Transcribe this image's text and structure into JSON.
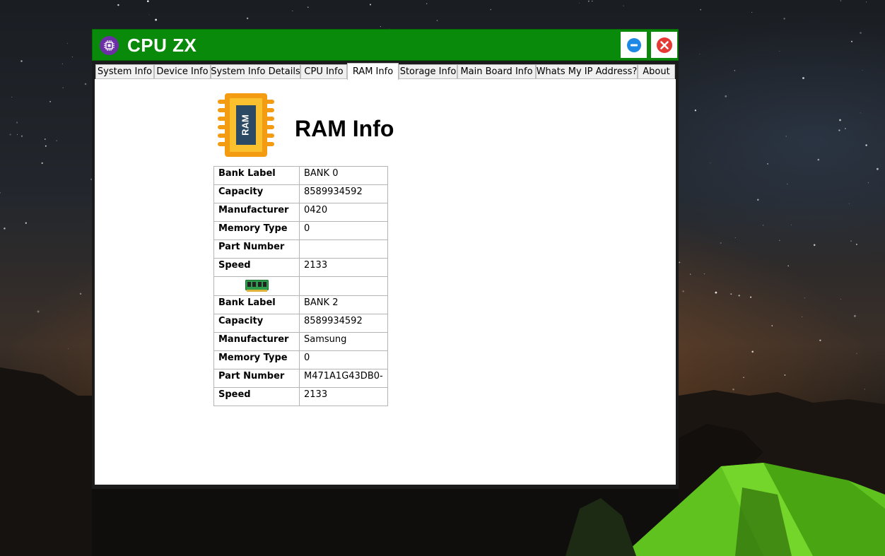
{
  "app": {
    "title": "CPU ZX"
  },
  "window_controls": {
    "minimize_icon": "minimize-icon",
    "close_icon": "close-icon"
  },
  "tabs": [
    {
      "label": "System Info",
      "active": false
    },
    {
      "label": "Device Info",
      "active": false
    },
    {
      "label": "System Info Details",
      "active": false
    },
    {
      "label": "CPU Info",
      "active": false
    },
    {
      "label": "RAM Info",
      "active": true
    },
    {
      "label": "Storage Info",
      "active": false
    },
    {
      "label": "Main Board Info",
      "active": false
    },
    {
      "label": "Whats My IP Address?",
      "active": false
    },
    {
      "label": "About",
      "active": false
    }
  ],
  "page": {
    "heading": "RAM Info",
    "icon": "ram-chip-icon",
    "icon_text": "RAM"
  },
  "banks": [
    {
      "rows": [
        {
          "label": "Bank Label",
          "value": "BANK 0"
        },
        {
          "label": "Capacity",
          "value": "8589934592"
        },
        {
          "label": "Manufacturer",
          "value": "0420"
        },
        {
          "label": "Memory Type",
          "value": "0"
        },
        {
          "label": "Part Number",
          "value": ""
        },
        {
          "label": "Speed",
          "value": "2133"
        }
      ]
    },
    {
      "rows": [
        {
          "label": "Bank Label",
          "value": "BANK 2"
        },
        {
          "label": "Capacity",
          "value": "8589934592"
        },
        {
          "label": "Manufacturer",
          "value": "Samsung"
        },
        {
          "label": "Memory Type",
          "value": "0"
        },
        {
          "label": "Part Number",
          "value": "M471A1G43DB0-"
        },
        {
          "label": "Speed",
          "value": "2133"
        }
      ]
    }
  ],
  "colors": {
    "titlebar": "#0a8a0a",
    "app_icon": "#6c2fa6",
    "minimize": "#1e88e5",
    "close": "#e53935",
    "chip": "#f39c12"
  }
}
